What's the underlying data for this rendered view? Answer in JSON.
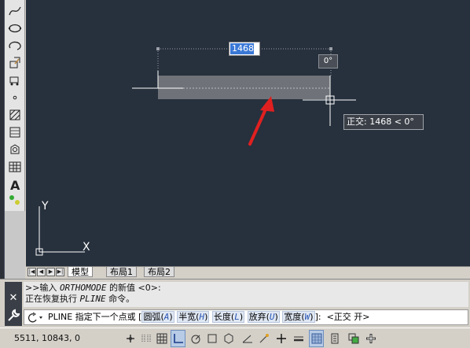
{
  "canvas": {
    "dynamic_input_value": "1468",
    "angle_readout": "0°",
    "tooltip": "正交: 1468 < 0°",
    "ucs_y_label": "Y",
    "ucs_x_label": "X"
  },
  "layout_tabs": {
    "tabs": [
      "模型",
      "布局1",
      "布局2"
    ]
  },
  "command_line": {
    "history_line1_prefix": ">>输入 ",
    "history_line1_var": "ORTHOMODE",
    "history_line1_suffix": " 的新值 <0>:",
    "history_line2_prefix": "正在恢复执行 ",
    "history_line2_cmd": "PLINE",
    "history_line2_suffix": " 命令。",
    "prompt_cmd": "PLINE 指定下一个点或 [",
    "options": [
      {
        "label": "圆弧",
        "key": "A"
      },
      {
        "label": "半宽",
        "key": "H"
      },
      {
        "label": "长度",
        "key": "L"
      },
      {
        "label": "放弃",
        "key": "U"
      },
      {
        "label": "宽度",
        "key": "W"
      }
    ],
    "prompt_end": "]:",
    "prompt_tail": "<正交 开>"
  },
  "status_bar": {
    "coordinates": "5511, 10843, 0"
  }
}
